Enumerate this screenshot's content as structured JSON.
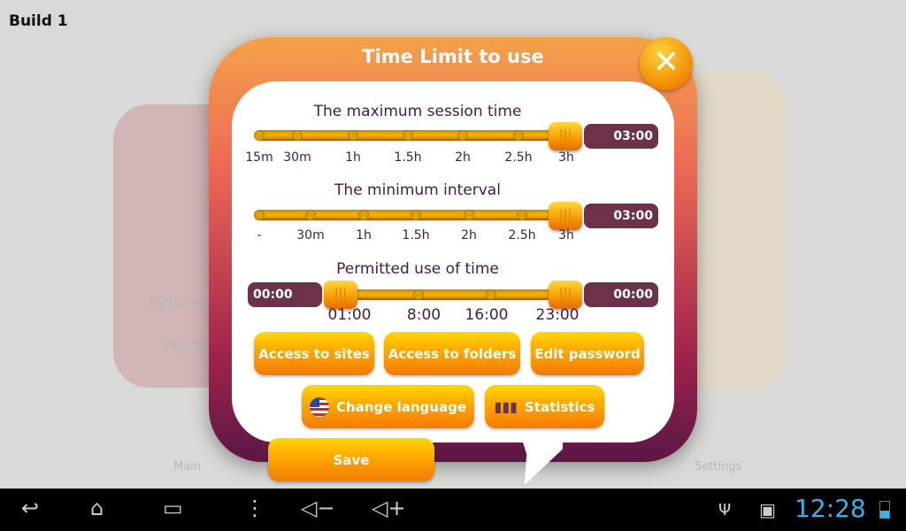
{
  "app": {
    "build_label": "Build 1"
  },
  "background": {
    "birthday": "Birthday",
    "hobby": "Hobby",
    "main": "Main",
    "settings": "Settings"
  },
  "dialog": {
    "title": "Time Limit to use",
    "close_icon": "close-icon",
    "sliders": [
      {
        "label": "The maximum session time",
        "value": "03:00",
        "ticks": [
          "15m",
          "30m",
          "1h",
          "1.5h",
          "2h",
          "2.5h",
          "3h"
        ]
      },
      {
        "label": "The minimum interval",
        "value": "03:00",
        "ticks": [
          "-",
          "30m",
          "1h",
          "1.5h",
          "2h",
          "2.5h",
          "3h"
        ]
      },
      {
        "label": "Permitted use of time",
        "start_value": "00:00",
        "end_value": "00:00",
        "ticks": [
          "01:00",
          "8:00",
          "16:00",
          "23:00"
        ]
      }
    ],
    "buttons": {
      "access_sites": "Access to sites",
      "access_folders": "Access to folders",
      "edit_password": "Edit password",
      "change_language": "Change language",
      "statistics": "Statistics",
      "save": "Save"
    }
  },
  "statusbar": {
    "time": "12:28"
  },
  "colors": {
    "accent": "#f59a00",
    "value_box": "#6b3249",
    "clock": "#33b5e5"
  }
}
